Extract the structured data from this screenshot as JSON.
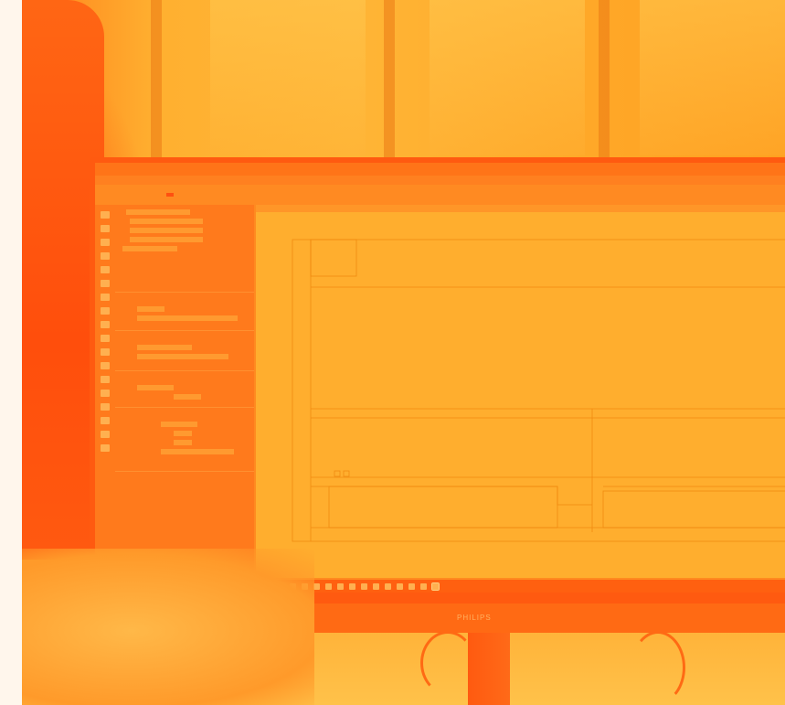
{
  "scene": {
    "tint": "#ffa020",
    "accent": "#ff5a10"
  },
  "monitor": {
    "brand": "PHILIPS"
  },
  "app": {
    "title": "",
    "ribbon": [
      {
        "label": "",
        "active": false
      },
      {
        "label": "",
        "active": true
      },
      {
        "label": "",
        "active": false
      },
      {
        "label": "",
        "active": false
      },
      {
        "label": "",
        "active": false
      },
      {
        "label": "",
        "active": false
      },
      {
        "label": "",
        "active": false
      }
    ],
    "sidebar_sections": 6,
    "taskbar_icon_count": 14
  }
}
